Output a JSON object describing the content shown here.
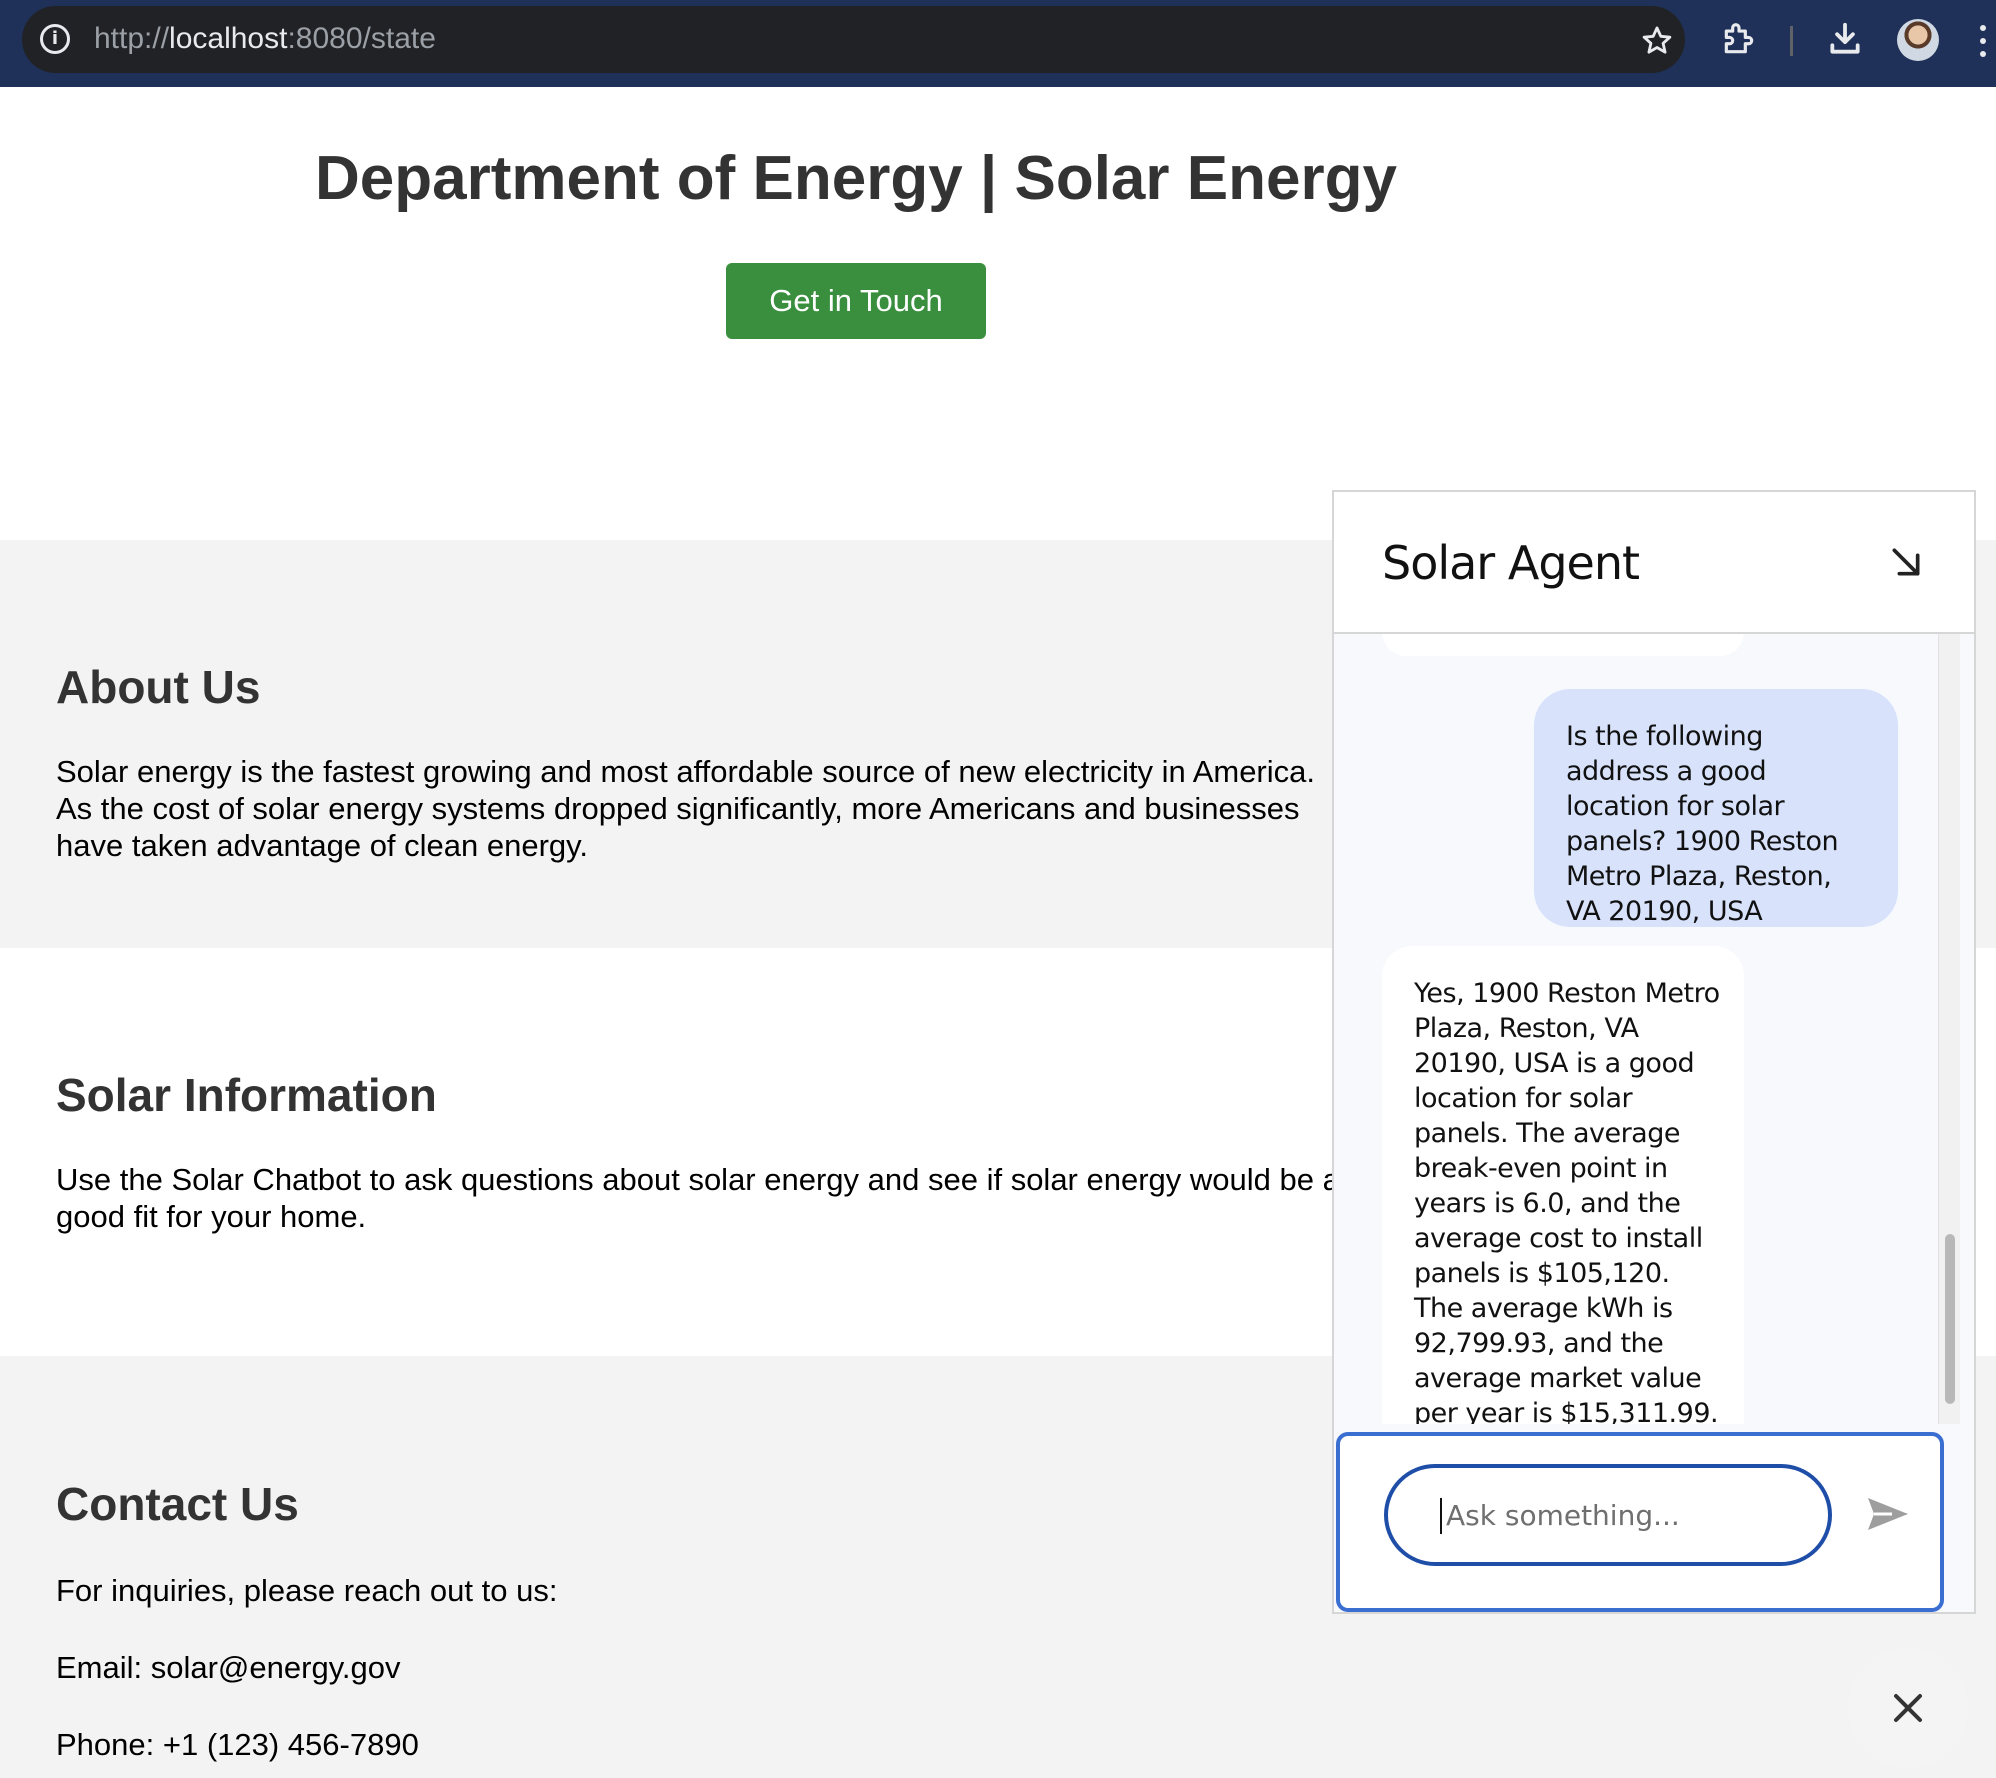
{
  "browser": {
    "url_scheme": "http://",
    "url_host": "localhost",
    "url_rest": ":8080/state"
  },
  "page": {
    "title": "Department of Energy | Solar Energy",
    "cta_label": "Get in Touch"
  },
  "about": {
    "heading": "About Us",
    "text": "Solar energy is the fastest growing and most affordable source of new electricity in America. As the cost of solar energy systems dropped significantly, more Americans and businesses have taken advantage of clean energy."
  },
  "solar_info": {
    "heading": "Solar Information",
    "text": "Use the Solar Chatbot to ask questions about solar energy and see if solar energy would be a good fit for your home."
  },
  "contact": {
    "heading": "Contact Us",
    "intro": "For inquiries, please reach out to us:",
    "email": "Email: solar@energy.gov",
    "phone": "Phone: +1 (123) 456-7890"
  },
  "chat": {
    "title": "Solar Agent",
    "messages": [
      {
        "role": "user",
        "text": "Is the following address a good location for solar panels? 1900 Reston Metro Plaza, Reston, VA 20190, USA"
      },
      {
        "role": "agent",
        "text": "Yes, 1900 Reston Metro Plaza, Reston, VA 20190, USA is a good location for solar panels. The average break-even point in years is 6.0, and the average cost to install panels is $105,120. The average kWh is 92,799.93, and the average market value per year is $15,311.99."
      }
    ],
    "input_placeholder": "Ask something...",
    "accent_color": "#1f4ea8",
    "user_bubble_color": "#d8e3fb"
  },
  "colors": {
    "cta": "#3a8f3f",
    "chrome": "#1f3158"
  }
}
